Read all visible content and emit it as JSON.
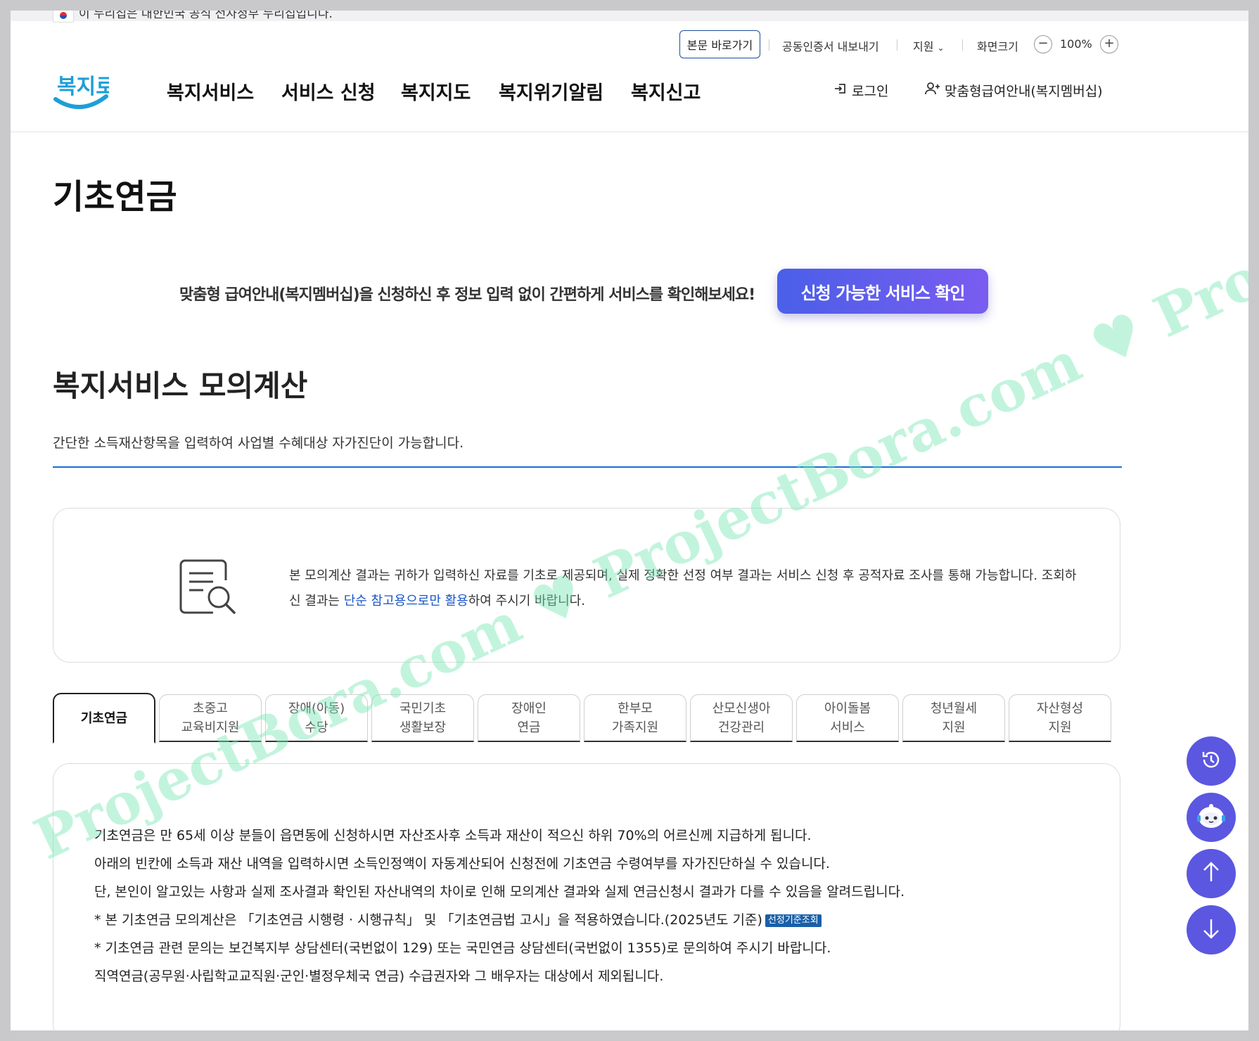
{
  "gov_banner": "이 누리집은 대한민국 공식 전자정부 누리집입니다.",
  "utility": {
    "skip_link": "본문 바로가기",
    "cert_export": "공동인증서 내보내기",
    "support": "지원",
    "screen_size": "화면크기",
    "zoom_out": "−",
    "zoom_value": "100%",
    "zoom_in": "+"
  },
  "logo_text": "복지로",
  "gnb": [
    "복지서비스",
    "서비스 신청",
    "복지지도",
    "복지위기알림",
    "복지신고"
  ],
  "header_actions": {
    "login": "로그인",
    "membership": "맞춤형급여안내(복지멤버십)"
  },
  "page_title": "기초연금",
  "promo": {
    "text": "맞춤형 급여안내(복지멤버십)을 신청하신 후 정보 입력 없이 간편하게 서비스를 확인해보세요!",
    "button": "신청 가능한 서비스 확인"
  },
  "section": {
    "title": "복지서비스 모의계산",
    "desc": "간단한 소득재산항목을 입력하여 사업별 수혜대상 자가진단이 가능합니다."
  },
  "notice": {
    "part1": "본 모의계산 결과는 귀하가 입력하신 자료를 기초로 제공되며, 실제 정확한 선정 여부 결과는 서비스 신청 후 공적자료 조사를 통해 가능합니다. 조회하신 결과는 ",
    "highlight": "단순 참고용으로만 활용",
    "part2": "하여 주시기 바랍니다."
  },
  "tabs": [
    {
      "line1": "기초연금",
      "line2": ""
    },
    {
      "line1": "초중고",
      "line2": "교육비지원"
    },
    {
      "line1": "장애(아동)",
      "line2": "수당"
    },
    {
      "line1": "국민기초",
      "line2": "생활보장"
    },
    {
      "line1": "장애인",
      "line2": "연금"
    },
    {
      "line1": "한부모",
      "line2": "가족지원"
    },
    {
      "line1": "산모신생아",
      "line2": "건강관리"
    },
    {
      "line1": "아이돌봄",
      "line2": "서비스"
    },
    {
      "line1": "청년월세",
      "line2": "지원"
    },
    {
      "line1": "자산형성",
      "line2": "지원"
    }
  ],
  "content": {
    "line1": "기초연금은 만 65세 이상 분들이 읍면동에 신청하시면 자산조사후 소득과 재산이 적으신 하위 70%의 어르신께 지급하게 됩니다.",
    "line2": "아래의 빈칸에 소득과 재산 내역을 입력하시면 소득인정액이 자동계산되어 신청전에 기초연금 수령여부를 자가진단하실 수 있습니다.",
    "line3": "단, 본인이 알고있는 사항과 실제 조사결과 확인된 자산내역의 차이로 인해 모의계산 결과와 실제 연금신청시 결과가 다를 수 있음을 알려드립니다.",
    "line4": "* 본 기초연금 모의계산은 「기초연금 시행령 · 시행규칙」 및 「기초연금법 고시」을 적용하였습니다.(2025년도 기준)",
    "badge": "선정기준조회",
    "line5": "* 기초연금 관련 문의는 보건복지부 상담센터(국번없이 129) 또는 국민연금 상담센터(국번없이 1355)로 문의하여 주시기 바랍니다.",
    "line6": "직역연금(공무원·사립학교교직원·군인·별정우체국 연금) 수급권자와 그 배우자는 대상에서 제외됩니다."
  },
  "watermark": "ProjectBora.com ♥ ProjectBora.com ♥ ProjectBora.com ♥",
  "colors": {
    "accent_blue": "#1a6dd4",
    "promo_gradient_start": "#4a5fe8",
    "promo_gradient_end": "#7a5cf0",
    "fab": "#5b57e0"
  }
}
